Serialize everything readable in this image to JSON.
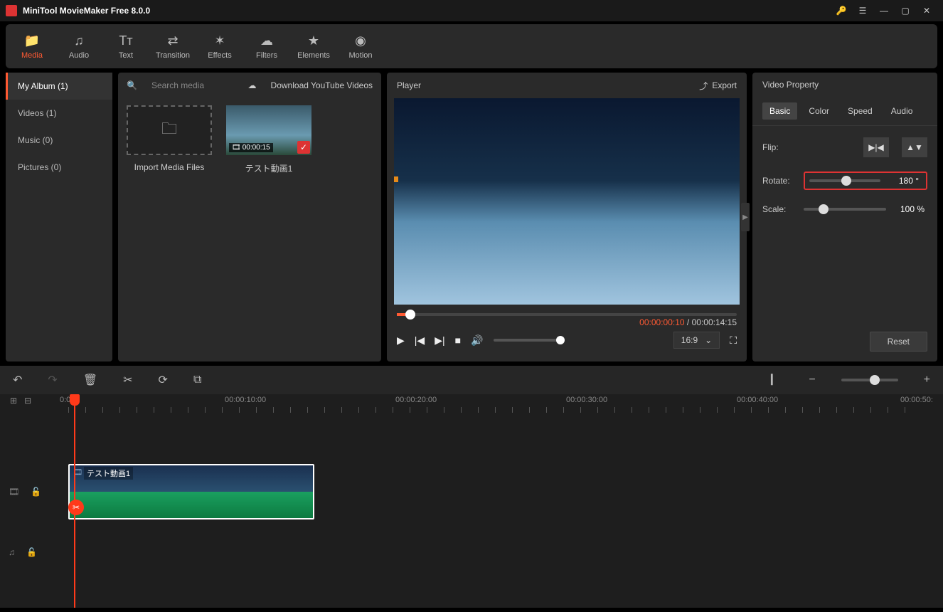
{
  "titlebar": {
    "title": "MiniTool MovieMaker Free 8.0.0"
  },
  "toolbar": {
    "tabs": [
      {
        "label": "Media",
        "icon": "📁",
        "active": true
      },
      {
        "label": "Audio",
        "icon": "♫"
      },
      {
        "label": "Text",
        "icon": "Tт"
      },
      {
        "label": "Transition",
        "icon": "⇄"
      },
      {
        "label": "Effects",
        "icon": "✶"
      },
      {
        "label": "Filters",
        "icon": "☁"
      },
      {
        "label": "Elements",
        "icon": "★"
      },
      {
        "label": "Motion",
        "icon": "◉"
      }
    ]
  },
  "sidebar": {
    "items": [
      {
        "label": "My Album (1)",
        "active": true
      },
      {
        "label": "Videos (1)"
      },
      {
        "label": "Music (0)"
      },
      {
        "label": "Pictures (0)"
      }
    ]
  },
  "media": {
    "search_placeholder": "Search media",
    "download_label": "Download YouTube Videos",
    "import_label": "Import Media Files",
    "clip": {
      "duration": "00:00:15",
      "name": "テスト動画1"
    }
  },
  "player": {
    "title": "Player",
    "export_label": "Export",
    "current_time": "00:00:00:10",
    "total_time": "00:00:14:15",
    "aspect": "16:9"
  },
  "props": {
    "title": "Video Property",
    "tabs": [
      "Basic",
      "Color",
      "Speed",
      "Audio"
    ],
    "flip_label": "Flip:",
    "rotate_label": "Rotate:",
    "rotate_value": "180 °",
    "scale_label": "Scale:",
    "scale_value": "100 %",
    "reset_label": "Reset"
  },
  "ruler": {
    "labels": [
      "0:00",
      "00:00:10:00",
      "00:00:20:00",
      "00:00:30:00",
      "00:00:40:00",
      "00:00:50:"
    ]
  },
  "clip_on_track": {
    "label": "テスト動画1"
  }
}
